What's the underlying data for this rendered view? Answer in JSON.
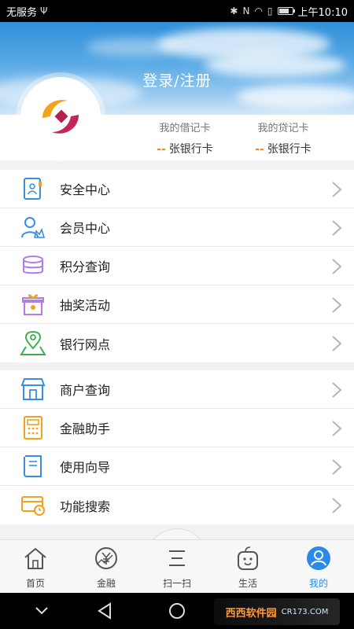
{
  "status_bar": {
    "carrier": "无服务",
    "time": "上午10:10"
  },
  "header": {
    "login_label": "登录/注册"
  },
  "cards": [
    {
      "title": "我的借记卡",
      "count": "--",
      "unit": "张银行卡"
    },
    {
      "title": "我的贷记卡",
      "count": "--",
      "unit": "张银行卡"
    }
  ],
  "menu_group_1": [
    {
      "label": "安全中心",
      "icon": "security-icon"
    },
    {
      "label": "会员中心",
      "icon": "member-icon"
    },
    {
      "label": "积分查询",
      "icon": "points-icon"
    },
    {
      "label": "抽奖活动",
      "icon": "gift-icon"
    },
    {
      "label": "银行网点",
      "icon": "location-icon"
    }
  ],
  "menu_group_2": [
    {
      "label": "商户查询",
      "icon": "store-icon"
    },
    {
      "label": "金融助手",
      "icon": "calculator-icon"
    },
    {
      "label": "使用向导",
      "icon": "book-icon"
    },
    {
      "label": "功能搜索",
      "icon": "card-clock-icon"
    }
  ],
  "tabs": [
    {
      "label": "首页",
      "icon": "home-icon",
      "active": false
    },
    {
      "label": "金融",
      "icon": "finance-icon",
      "active": false
    },
    {
      "label": "扫一扫",
      "icon": "scan-icon",
      "active": false
    },
    {
      "label": "生活",
      "icon": "life-icon",
      "active": false
    },
    {
      "label": "我的",
      "icon": "profile-icon",
      "active": true
    }
  ],
  "watermark": {
    "brand": "西西软件园",
    "domain": "CR173.COM"
  },
  "colors": {
    "accent": "#2b8ae8",
    "orange": "#f28a1c",
    "icon_blue": "#3a8ee0"
  }
}
